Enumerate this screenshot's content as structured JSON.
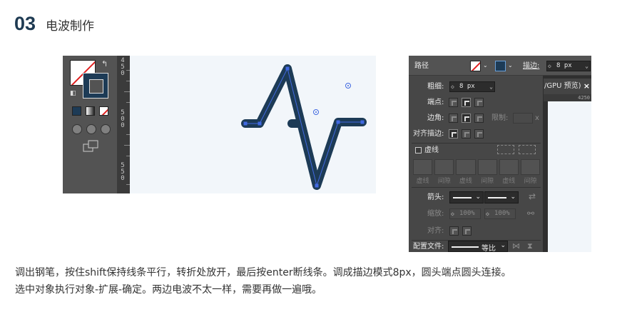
{
  "header": {
    "number": "03",
    "title": "电波制作"
  },
  "left_screenshot": {
    "ruler_labels": [
      "450",
      "500",
      "550"
    ],
    "wave_color": "#1d3b56",
    "path_color": "#4169e1",
    "canvas_bg": "#f2f6fa"
  },
  "stroke_panel": {
    "title": "路径",
    "stroke_label": "描边:",
    "stroke_value": "8 px",
    "weight_label": "粗细:",
    "weight_value": "8 px",
    "cap_label": "端点:",
    "corner_label": "边角:",
    "limit_label": "限制:",
    "limit_unit": "x",
    "align_label": "对齐描边:",
    "dashed_label": "虚线",
    "dash_labels": [
      "虚线",
      "间隙",
      "虚线",
      "间隙",
      "虚线",
      "间隙"
    ],
    "arrow_label": "箭头:",
    "scale_label": "缩放:",
    "scale_values": [
      "100%",
      "100%"
    ],
    "align_arrow_label": "对齐:",
    "profile_label": "配置文件:",
    "profile_value": "等比",
    "doc_tab": "/GPU 预览)",
    "doc_ruler": "4250"
  },
  "caption": {
    "line1": "调出钢笔，按住shift保持线条平行，转折处放开，最后按enter断线条。调成描边模式8px，圆头端点圆头连接。",
    "line2": "选中对象执行对象-扩展-确定。两边电波不太一样，需要再做一遍哦。"
  }
}
